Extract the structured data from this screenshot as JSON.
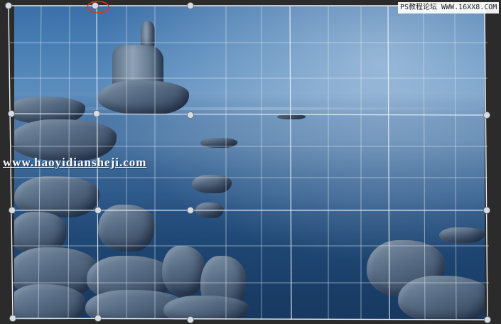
{
  "watermarks": {
    "forum": "PS教程论坛 WWW.16XX8.COM",
    "site": "www.haoyidiansheji.com"
  },
  "crop_tool": {
    "grid_color": "#dfe6ee",
    "handle_color": "#d9dde2",
    "highlight_circle_color": "#d9381e"
  }
}
